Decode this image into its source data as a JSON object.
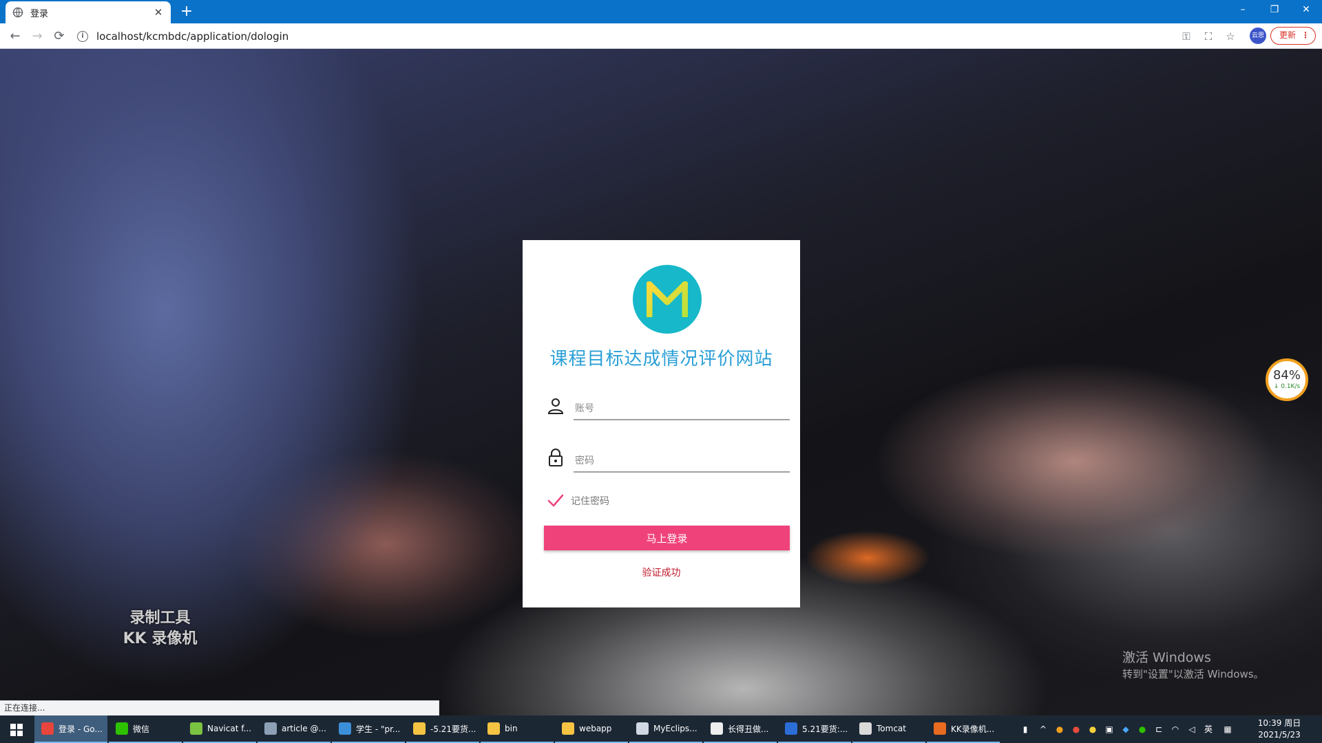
{
  "browser": {
    "tab_title": "登录",
    "new_tab": "+",
    "url": "localhost/kcmbdc/application/dologin",
    "update_label": "更新",
    "update_menu": "⋮",
    "profile_label": "云思",
    "status_text": "正在连接...",
    "win_controls": [
      "–",
      "❐",
      "✕"
    ]
  },
  "login": {
    "site_title": "课程目标达成情况评价网站",
    "logo_letter": "M",
    "account_placeholder": "账号",
    "password_placeholder": "密码",
    "remember_label": "记住密码",
    "remember_checked": true,
    "submit_label": "马上登录",
    "verify_message": "验证成功",
    "accent_color": "#f0427a",
    "title_color": "#2a9fd6"
  },
  "overlays": {
    "recorder_line1": "录制工具",
    "recorder_line2": "KK 录像机",
    "activate_title": "激活 Windows",
    "activate_sub": "转到\"设置\"以激活 Windows。",
    "speed_percent": "84%",
    "speed_rate": "↓ 0.1K/s"
  },
  "taskbar": {
    "items": [
      {
        "label": "登录 - Go...",
        "icon": "chrome-icon",
        "color": "#e8453c"
      },
      {
        "label": "微信",
        "icon": "wechat-icon",
        "color": "#2dc100"
      },
      {
        "label": "Navicat f...",
        "icon": "navicat-icon",
        "color": "#7cc242"
      },
      {
        "label": "article @...",
        "icon": "article-icon",
        "color": "#8da0b6"
      },
      {
        "label": "学生 - \"pr...",
        "icon": "editor-icon",
        "color": "#3c8fd9"
      },
      {
        "label": "-5.21要货...",
        "icon": "folder-icon",
        "color": "#f6c342"
      },
      {
        "label": "bin",
        "icon": "folder-icon",
        "color": "#f6c342"
      },
      {
        "label": "webapp",
        "icon": "folder-icon",
        "color": "#f6c342"
      },
      {
        "label": "MyEclips...",
        "icon": "eclipse-icon",
        "color": "#cfd8e3"
      },
      {
        "label": "长得丑做...",
        "icon": "qq-icon",
        "color": "#eeeeee"
      },
      {
        "label": "5.21要货:...",
        "icon": "word-icon",
        "color": "#2b6ed8"
      },
      {
        "label": "Tomcat",
        "icon": "tomcat-icon",
        "color": "#d9d9d9"
      },
      {
        "label": "KK录像机...",
        "icon": "kk-icon",
        "color": "#e86b1f"
      }
    ],
    "ime": "英",
    "time": "10:39 周日",
    "date": "2021/5/23"
  }
}
